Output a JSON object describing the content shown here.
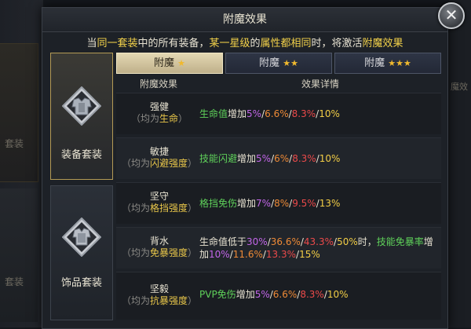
{
  "panel": {
    "title": "附魔效果",
    "close_glyph": "✕",
    "notice": {
      "p1": "当",
      "p2": "同一套装",
      "p3": "中的所有装备，",
      "p4": "某一星级",
      "p5": "的",
      "p6": "属性都相同",
      "p7": "时，将激活",
      "p8": "附魔效果"
    }
  },
  "tabs": [
    {
      "label": "附魔",
      "stars": "★",
      "selected": true
    },
    {
      "label": "附魔",
      "stars": "★★",
      "selected": false
    },
    {
      "label": "附魔",
      "stars": "★★★",
      "selected": false
    }
  ],
  "categories": [
    {
      "label": "装备套装",
      "icon": "armor-icon",
      "selected": true
    },
    {
      "label": "饰品套装",
      "icon": "accessory-icon",
      "selected": false
    }
  ],
  "table": {
    "col1": "附魔效果",
    "col2": "效果详情",
    "sep": "/",
    "rows": [
      {
        "name": "强健",
        "sub_pre": "（均为",
        "sub_hl": "生命",
        "sub_post": "）",
        "d_label": "生命值",
        "d_mid": "增加",
        "v1": "5%",
        "v2": "6.6%",
        "v3": "8.3%",
        "v4": "10%"
      },
      {
        "name": "敏捷",
        "sub_pre": "（均为",
        "sub_hl": "闪避强度",
        "sub_post": "）",
        "d_label": "技能闪避",
        "d_mid": "增加",
        "v1": "5%",
        "v2": "6%",
        "v3": "8.3%",
        "v4": "10%"
      },
      {
        "name": "坚守",
        "sub_pre": "（均为",
        "sub_hl": "格挡强度",
        "sub_post": "）",
        "d_label": "格挡免伤",
        "d_mid": "增加",
        "v1": "7%",
        "v2": "8%",
        "v3": "9.5%",
        "v4": "13%"
      },
      {
        "name": "背水",
        "sub_pre": "（均为",
        "sub_hl": "免暴强度",
        "sub_post": "）",
        "d_pre": "生命值低于",
        "t1": "30%",
        "t2": "36.6%",
        "t3": "43.3%",
        "t4": "50%",
        "d_when": "时，",
        "d_label": "技能免暴率",
        "d_mid": "增加",
        "v1": "10%",
        "v2": "11.6%",
        "v3": "13.3%",
        "v4": "15%"
      },
      {
        "name": "坚毅",
        "sub_pre": "（均为",
        "sub_hl": "抗暴强度",
        "sub_post": "）",
        "d_label": "PVP免伤",
        "d_mid": "增加",
        "v1": "5%",
        "v2": "6.6%",
        "v3": "8.3%",
        "v4": "10%"
      }
    ]
  },
  "background": {
    "left_text_1": "套装",
    "left_text_2": "套装",
    "right_text": "魔效"
  }
}
